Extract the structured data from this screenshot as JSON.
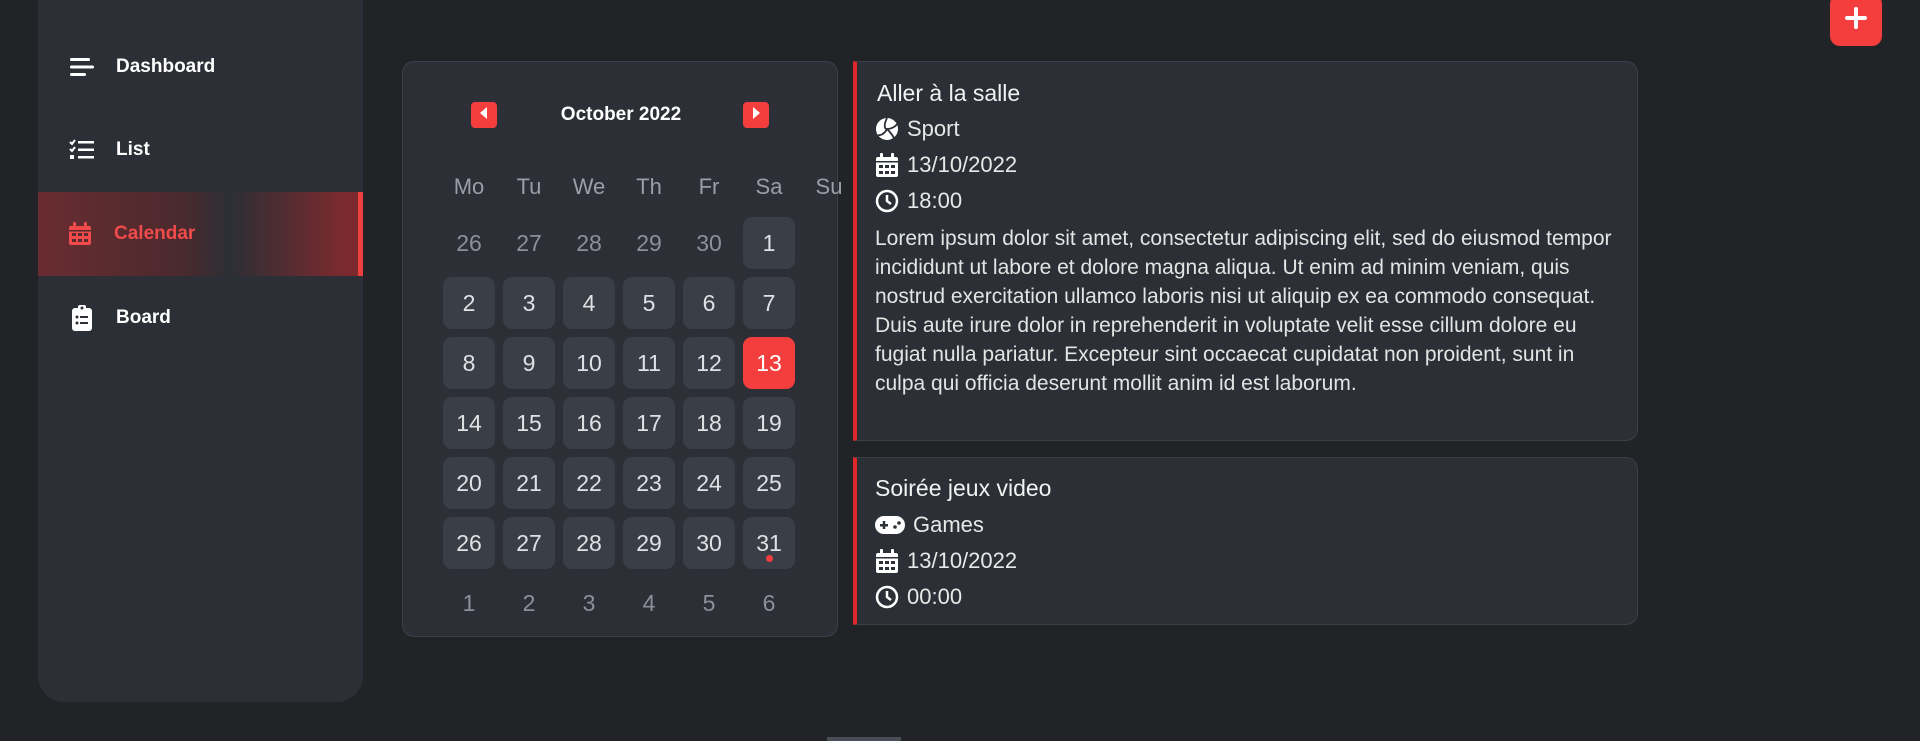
{
  "sidebar": {
    "items": [
      {
        "label": "Dashboard",
        "icon": "menu-icon"
      },
      {
        "label": "List",
        "icon": "checklist-icon"
      },
      {
        "label": "Calendar",
        "icon": "calendar-icon",
        "active": true
      },
      {
        "label": "Board",
        "icon": "clipboard-icon"
      }
    ]
  },
  "calendar": {
    "title": "October 2022",
    "weekdays": [
      "Mo",
      "Tu",
      "We",
      "Th",
      "Fr",
      "Sa",
      "Su"
    ],
    "weeks": [
      [
        {
          "d": "26",
          "t": "muted"
        },
        {
          "d": "27",
          "t": "muted"
        },
        {
          "d": "28",
          "t": "muted"
        },
        {
          "d": "29",
          "t": "muted"
        },
        {
          "d": "30",
          "t": "muted"
        },
        {
          "d": "1",
          "t": "cur"
        }
      ],
      [
        {
          "d": "2",
          "t": "cur"
        },
        {
          "d": "3",
          "t": "cur"
        },
        {
          "d": "4",
          "t": "cur"
        },
        {
          "d": "5",
          "t": "cur"
        },
        {
          "d": "6",
          "t": "cur"
        },
        {
          "d": "7",
          "t": "cur"
        }
      ],
      [
        {
          "d": "8",
          "t": "cur"
        },
        {
          "d": "9",
          "t": "cur"
        },
        {
          "d": "10",
          "t": "cur"
        },
        {
          "d": "11",
          "t": "cur"
        },
        {
          "d": "12",
          "t": "cur"
        },
        {
          "d": "13",
          "t": "sel"
        }
      ],
      [
        {
          "d": "14",
          "t": "cur"
        },
        {
          "d": "15",
          "t": "cur"
        },
        {
          "d": "16",
          "t": "cur"
        },
        {
          "d": "17",
          "t": "cur"
        },
        {
          "d": "18",
          "t": "cur"
        },
        {
          "d": "19",
          "t": "cur"
        }
      ],
      [
        {
          "d": "20",
          "t": "cur"
        },
        {
          "d": "21",
          "t": "cur"
        },
        {
          "d": "22",
          "t": "cur"
        },
        {
          "d": "23",
          "t": "cur"
        },
        {
          "d": "24",
          "t": "cur"
        },
        {
          "d": "25",
          "t": "cur"
        }
      ],
      [
        {
          "d": "26",
          "t": "cur"
        },
        {
          "d": "27",
          "t": "cur"
        },
        {
          "d": "28",
          "t": "cur"
        },
        {
          "d": "29",
          "t": "cur"
        },
        {
          "d": "30",
          "t": "cur"
        },
        {
          "d": "31",
          "t": "cur",
          "dot": true
        }
      ],
      [
        {
          "d": "1",
          "t": "muted"
        },
        {
          "d": "2",
          "t": "muted"
        },
        {
          "d": "3",
          "t": "muted"
        },
        {
          "d": "4",
          "t": "muted"
        },
        {
          "d": "5",
          "t": "muted"
        },
        {
          "d": "6",
          "t": "muted"
        }
      ]
    ]
  },
  "events": [
    {
      "title": "Aller à la salle",
      "category": "Sport",
      "category_icon": "volleyball-icon",
      "date": "13/10/2022",
      "time": "18:00",
      "description": "Lorem ipsum dolor sit amet, consectetur adipiscing elit, sed do eiusmod tempor incididunt ut labore et dolore magna aliqua. Ut enim ad minim veniam, quis nostrud exercitation ullamco laboris nisi ut aliquip ex ea commodo consequat. Duis aute irure dolor in reprehenderit in voluptate velit esse cillum dolore eu fugiat nulla pariatur. Excepteur sint occaecat cupidatat non proident, sunt in culpa qui officia deserunt mollit anim id est laborum."
    },
    {
      "title": "Soirée jeux video",
      "category": "Games",
      "category_icon": "gamepad-icon",
      "date": "13/10/2022",
      "time": "00:00"
    }
  ],
  "colors": {
    "accent": "#f43e3e",
    "background": "#212327",
    "panel": "#2c2f35"
  }
}
